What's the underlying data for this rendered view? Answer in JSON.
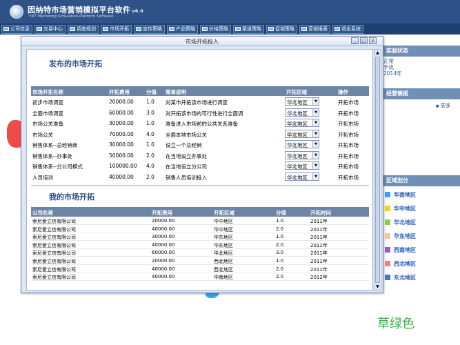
{
  "app": {
    "title": "因纳特市场营销模拟平台软件",
    "version": "v6.0",
    "subtitle": "YNT Marketing Simulation Platform Software"
  },
  "nav": [
    "公司信息",
    "交易中心",
    "调查规划",
    "市场开拓",
    "宣传策略",
    "产品策略",
    "价格策略",
    "渠道策略",
    "促销策略",
    "营销报表",
    "退出系统"
  ],
  "side": {
    "status_title": "实验状态",
    "status_values": [
      "正常",
      "手机",
      "2014年"
    ],
    "biz_title": "经营情报",
    "more": "更多",
    "region_title": "区域划分",
    "regions": [
      {
        "name": "华南地区",
        "color": "#3aa0f0"
      },
      {
        "name": "华中地区",
        "color": "#f5d21c"
      },
      {
        "name": "华北地区",
        "color": "#8cd04a"
      },
      {
        "name": "华东地区",
        "color": "#f2c79a"
      },
      {
        "name": "西南地区",
        "color": "#9a5ad0"
      },
      {
        "name": "西北地区",
        "color": "#f08080"
      },
      {
        "name": "东北地区",
        "color": "#3a7ad0"
      }
    ]
  },
  "theme_label": "草绿色",
  "modal": {
    "title": "市场开拓投入",
    "section1_title": "发布的市场开拓",
    "section2_title": "我的市场开拓",
    "table1": {
      "headers": [
        "市场开拓名称",
        "开拓费用",
        "分值",
        "简单说明",
        "开拓区域",
        "操作"
      ],
      "rows": [
        {
          "name": "初步市场调查",
          "cost": "20000.00",
          "score": "1.0",
          "desc": "对某市开拓该市场进行调查",
          "region": "华北地区",
          "op": "开拓市场"
        },
        {
          "name": "全面市场调查",
          "cost": "60000.00",
          "score": "3.0",
          "desc": "对开拓该市场的可行性进行全面调",
          "region": "华北地区",
          "op": "开拓市场"
        },
        {
          "name": "市场公关准备",
          "cost": "30000.00",
          "score": "1.0",
          "desc": "准备进入市场前的公共关系准备",
          "region": "华北地区",
          "op": "开拓市场"
        },
        {
          "name": "市场公关",
          "cost": "70000.00",
          "score": "4.0",
          "desc": "全面本地市场公关",
          "region": "华北地区",
          "op": "开拓市场"
        },
        {
          "name": "销售体系--总经销商",
          "cost": "30000.00",
          "score": "1.0",
          "desc": "设立一个总经销",
          "region": "华北地区",
          "op": "开拓市场"
        },
        {
          "name": "销售体系--办事处",
          "cost": "50000.00",
          "score": "2.0",
          "desc": "在当地设立办事处",
          "region": "华北地区",
          "op": "开拓市场"
        },
        {
          "name": "销售体系--分公司模式",
          "cost": "100000.00",
          "score": "4.0",
          "desc": "在当地设立分公司",
          "region": "华北地区",
          "op": "开拓市场"
        },
        {
          "name": "人员培训",
          "cost": "40000.00",
          "score": "2.0",
          "desc": "销售人员培训投入",
          "region": "华北地区",
          "op": "开拓市场"
        }
      ]
    },
    "table2": {
      "headers": [
        "公司名称",
        "开拓费用",
        "开拓区域",
        "分值",
        "开拓时间"
      ],
      "rows": [
        {
          "company": "索尼爱立信有限公司",
          "cost": "20000.00",
          "region": "华中地区",
          "score": "1.0",
          "time": "2011年"
        },
        {
          "company": "索尼爱立信有限公司",
          "cost": "40000.00",
          "region": "华中地区",
          "score": "2.0",
          "time": "2011年"
        },
        {
          "company": "索尼爱立信有限公司",
          "cost": "30000.00",
          "region": "华东地区",
          "score": "1.0",
          "time": "2011年"
        },
        {
          "company": "索尼爱立信有限公司",
          "cost": "40000.00",
          "region": "华东地区",
          "score": "2.0",
          "time": "2011年"
        },
        {
          "company": "索尼爱立信有限公司",
          "cost": "60000.00",
          "region": "华北地区",
          "score": "3.0",
          "time": "2011年"
        },
        {
          "company": "索尼爱立信有限公司",
          "cost": "20000.00",
          "region": "西北地区",
          "score": "1.0",
          "time": "2011年"
        },
        {
          "company": "索尼爱立信有限公司",
          "cost": "40000.00",
          "region": "西北地区",
          "score": "2.0",
          "time": "2011年"
        },
        {
          "company": "索尼爱立信有限公司",
          "cost": "40000.00",
          "region": "华南地区",
          "score": "2.0",
          "time": "2012年"
        }
      ]
    }
  }
}
